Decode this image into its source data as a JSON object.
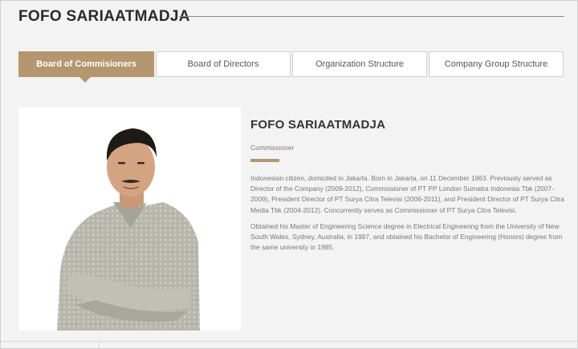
{
  "header": {
    "title": "FOFO SARIAATMADJA"
  },
  "tabs": [
    {
      "label": "Board of Commisioners",
      "active": true
    },
    {
      "label": "Board of Directors",
      "active": false
    },
    {
      "label": "Organization Structure",
      "active": false
    },
    {
      "label": "Company Group Structure",
      "active": false
    }
  ],
  "profile": {
    "name": "FOFO SARIAATMADJA",
    "role": "Commissioner",
    "bio": [
      "Indonesian citizen, domiciled in Jakarta. Born in Jakarta, on 11 December 1963. Previously served as Director of the Company (2009-2012), Commissioner of PT PP London Sumatra Indonesia Tbk (2007-2009), President Director of PT Surya Citra Televisi (2006-2011), and President Director of PT Surya Citra Media Tbk (2004-2012). Concurrently serves as Commissioner of PT Surya Citra Televisi.",
      "Obtained his Master of Engineering Science degree in Electrical Engineering from the University of New South Wales, Sydney, Australia, in 1987, and obtained his Bachelor of Engineering (Honors) degree from the same university in 1985."
    ]
  },
  "colors": {
    "accent": "#b5976f",
    "background": "#f3f3f3",
    "title_text": "#2b2b2b",
    "body_text": "#777777"
  }
}
